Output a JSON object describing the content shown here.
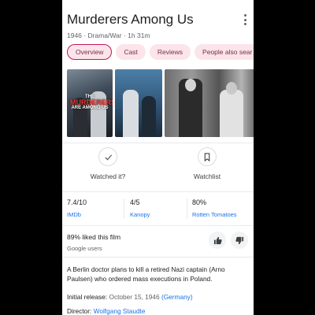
{
  "header": {
    "title": "Murderers Among Us",
    "subtitle": "1946 · Drama/War · 1h 31m"
  },
  "tabs": [
    {
      "label": "Overview"
    },
    {
      "label": "Cast"
    },
    {
      "label": "Reviews"
    },
    {
      "label": "People also sear"
    }
  ],
  "gallery": {
    "poster_text_top": "THE",
    "poster_text_main": "MURDERERS",
    "poster_text_bottom": "ARE AMONG US"
  },
  "actions": {
    "watched": "Watched it?",
    "watchlist": "Watchlist"
  },
  "ratings": [
    {
      "score": "7.4/10",
      "source": "IMDb"
    },
    {
      "score": "4/5",
      "source": "Kanopy"
    },
    {
      "score": "80%",
      "source": "Rotten Tomatoes"
    }
  ],
  "audience": {
    "liked": "89% liked this film",
    "source": "Google users"
  },
  "description": "A Berlin doctor plans to kill a retired Nazi captain (Arno Paulsen) who ordered mass executions in Poland.",
  "details": {
    "release_label": "Initial release:",
    "release_date": "October 15, 1946",
    "release_country": "(Germany)",
    "director_label": "Director:",
    "director": "Wolfgang Staudte"
  },
  "colors": {
    "tab_bg": "#fbe4ea",
    "tab_active_border": "#c2185b",
    "link": "#1a73e8"
  }
}
